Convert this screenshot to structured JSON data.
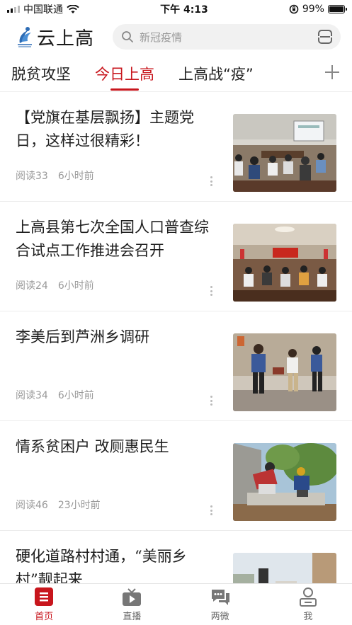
{
  "status": {
    "carrier": "中国联通",
    "time": "下午 4:13",
    "battery": "99%",
    "battery_level": 0.99
  },
  "header": {
    "app_name": "云上高",
    "search_placeholder": "新冠疫情"
  },
  "tabs": [
    {
      "label": "脱贫攻坚",
      "active": false
    },
    {
      "label": "今日上高",
      "active": true
    },
    {
      "label": "上高战“疫”",
      "active": false
    }
  ],
  "articles": [
    {
      "title": "【党旗在基层飘扬】主题党日，这样过很精彩！",
      "reads": "阅读33",
      "time": "6小时前",
      "thumb": "meeting-room-photo"
    },
    {
      "title": "上高县第七次全国人口普查综合试点工作推进会召开",
      "reads": "阅读24",
      "time": "6小时前",
      "thumb": "conference-hall-photo"
    },
    {
      "title": "李美后到芦洲乡调研",
      "reads": "阅读34",
      "time": "6小时前",
      "thumb": "village-visit-photo"
    },
    {
      "title": "情系贫困户  改厕惠民生",
      "reads": "阅读46",
      "time": "23小时前",
      "thumb": "construction-workers-photo"
    },
    {
      "title": "硬化道路村村通，“美丽乡村”靓起来",
      "reads": "",
      "time": "",
      "thumb": "village-road-photo"
    }
  ],
  "bottom_nav": [
    {
      "label": "首页",
      "icon": "home-icon",
      "active": true
    },
    {
      "label": "直播",
      "icon": "tv-icon",
      "active": false
    },
    {
      "label": "两微",
      "icon": "chat-icon",
      "active": false
    },
    {
      "label": "我",
      "icon": "user-icon",
      "active": false
    }
  ],
  "colors": {
    "accent": "#c8161d",
    "muted": "#999999"
  }
}
